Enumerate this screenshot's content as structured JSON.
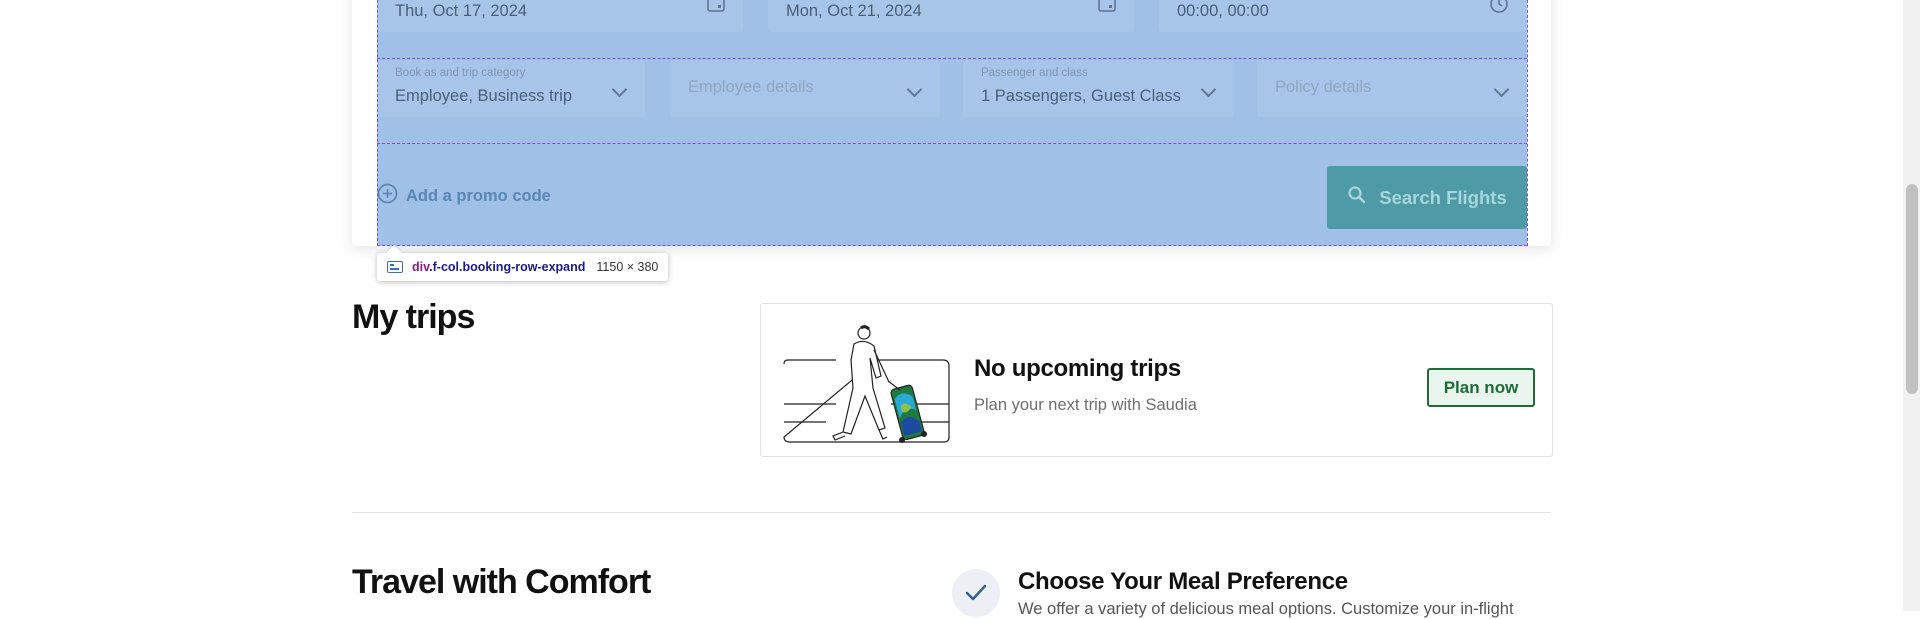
{
  "booking": {
    "depart_date": "Thu, Oct 17, 2024",
    "return_date": "Mon, Oct 21, 2024",
    "time_value": "00:00, 00:00",
    "book_as_label": "Book as and trip category",
    "book_as_value": "Employee, Business trip",
    "employee_placeholder": "Employee details",
    "passenger_label": "Passenger and class",
    "passenger_value": "1 Passengers, Guest Class",
    "policy_placeholder": "Policy details",
    "promo_label": "Add a promo code",
    "search_label": "Search Flights"
  },
  "devtools_tooltip": {
    "tag": "div",
    "classes": ".f-col.booking-row-expand",
    "size": "1150 × 380"
  },
  "my_trips": {
    "title": "My trips",
    "heading": "No upcoming trips",
    "subtext": "Plan your next trip with Saudia",
    "plan_button": "Plan now"
  },
  "comfort": {
    "title": "Travel with Comfort",
    "item_title": "Choose Your Meal Preference",
    "item_text": "We offer a variety of delicious meal options. Customize your in-flight"
  },
  "colors": {
    "highlight": "#6fa0dc",
    "search_button": "#4e9aa6",
    "plan_border": "#1e6b3a"
  }
}
